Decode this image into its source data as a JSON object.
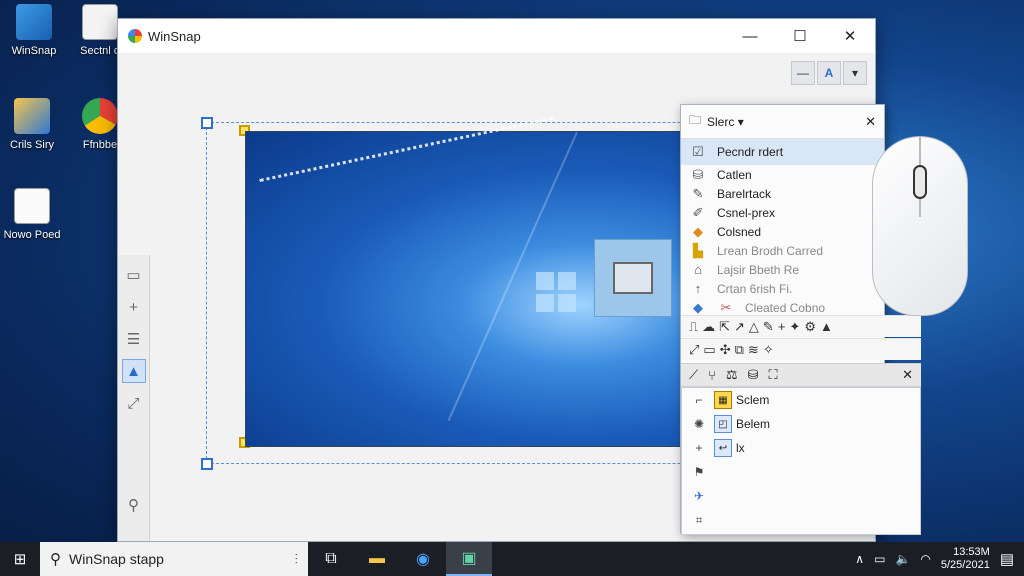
{
  "desktop": {
    "icons": [
      {
        "label": "WinSnap"
      },
      {
        "label": "Sectnl o"
      },
      {
        "label": "Crils Siry"
      },
      {
        "label": "Ffnbbe"
      },
      {
        "label": "Nowo Poed"
      }
    ]
  },
  "window": {
    "title": "WinSnap",
    "controls": {
      "minimize": "—",
      "maximize": "☐",
      "close": "✕"
    },
    "toolbar_right": {
      "b1": "—",
      "b2": "A",
      "b3": "▾"
    }
  },
  "menu": {
    "header": "Slerc ▾",
    "close": "✕",
    "items": [
      {
        "label": "Pecndr rdert"
      },
      {
        "label": "Catlen"
      },
      {
        "label": "Barelrtack"
      },
      {
        "label": "Csnel-prex"
      },
      {
        "label": "Colsned"
      },
      {
        "label": "Lrean Brodh Carred"
      },
      {
        "label": "Lajsir Bbeth Re"
      },
      {
        "label": "Crtan 6rish  Fi."
      },
      {
        "label": "Cleated Cobno"
      }
    ],
    "sub": {
      "close": "✕",
      "items": [
        {
          "label": "Sclem"
        },
        {
          "label": "Belem"
        },
        {
          "label": "lx"
        }
      ]
    }
  },
  "taskbar": {
    "search_text": "WinSnap stapp",
    "clock_time": "13:53M",
    "clock_date": "5/25/2021"
  }
}
